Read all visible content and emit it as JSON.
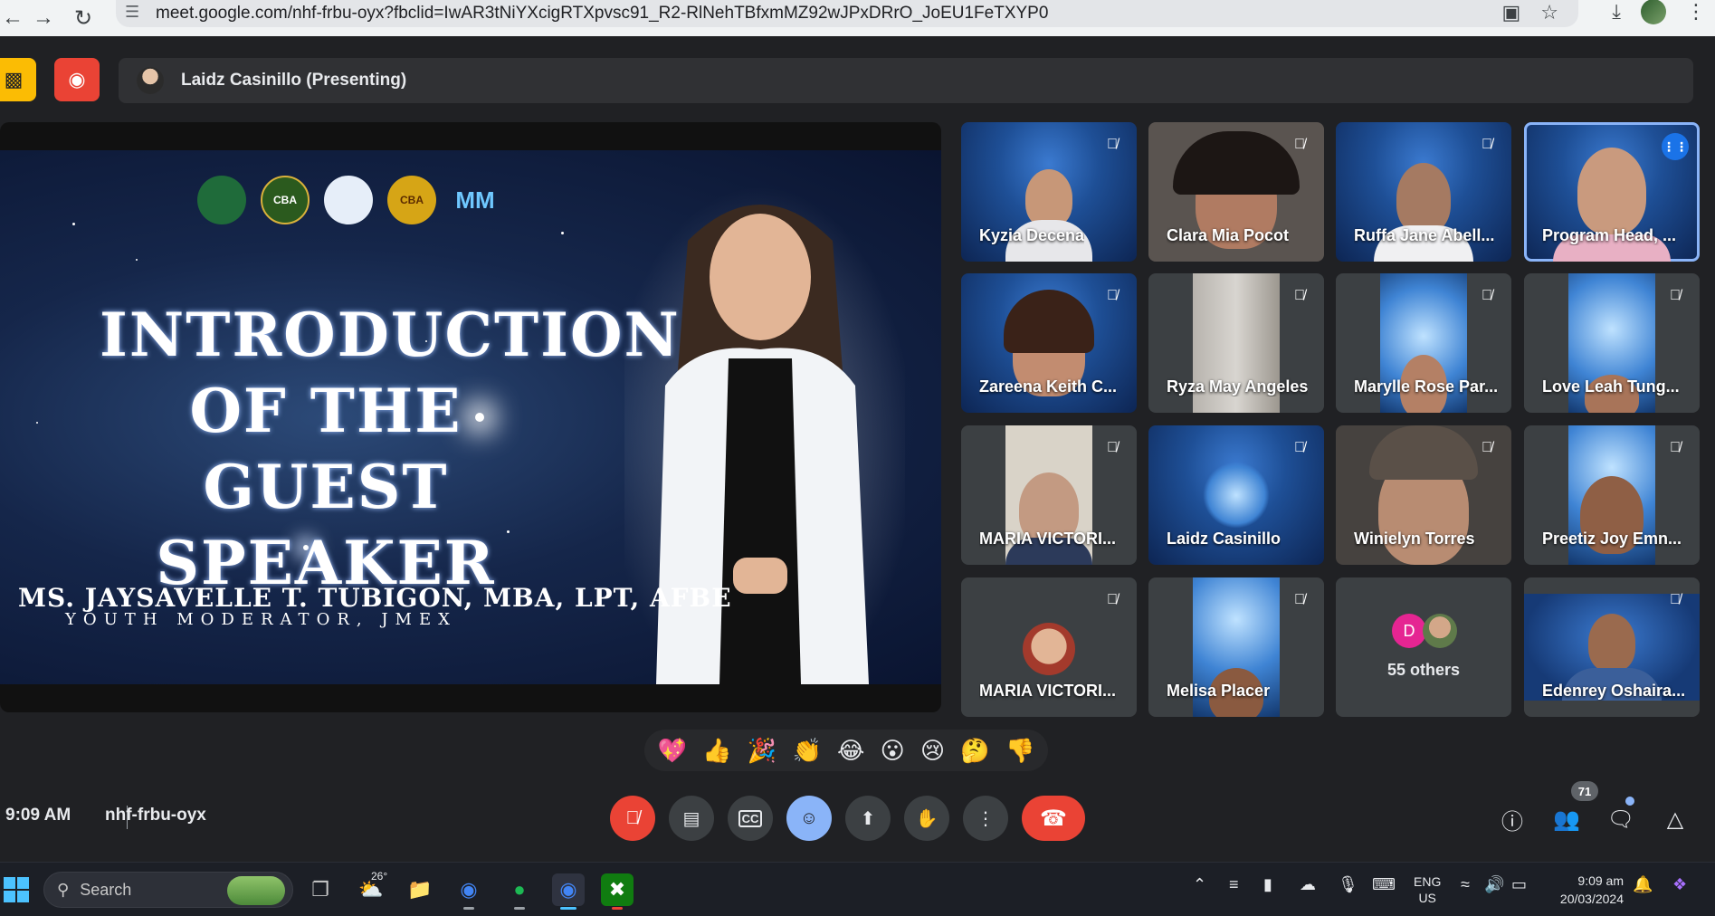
{
  "browser": {
    "url": "meet.google.com/nhf-frbu-oyx?fbclid=IwAR3tNiYXcigRTXpvsc91_R2-RlNehTBfxmMZ92wJPxDRrO_JoEU1FeTXYP0"
  },
  "top_bar": {
    "presenter_label": "Laidz Casinillo (Presenting)"
  },
  "slide": {
    "logo_labels": [
      "",
      "CBA",
      "",
      "CBA",
      "MM"
    ],
    "title_lines": [
      "INTRODUCTION",
      "OF THE",
      "GUEST SPEAKER"
    ],
    "speaker_name": "MS. JAYSAVELLE T. TUBIGON, MBA, LPT, AFBE",
    "speaker_role": "YOUTH MODERATOR, JMEX"
  },
  "participants": [
    {
      "name": "Kyzia Decena"
    },
    {
      "name": "Clara Mia Pocot"
    },
    {
      "name": "Ruffa Jane Abell..."
    },
    {
      "name": "Program Head, ..."
    },
    {
      "name": "Zareena Keith C..."
    },
    {
      "name": "Ryza May Angeles"
    },
    {
      "name": "Marylle Rose Par..."
    },
    {
      "name": "Love Leah Tung..."
    },
    {
      "name": "MARIA VICTORI..."
    },
    {
      "name": "Laidz Casinillo"
    },
    {
      "name": "Winielyn Torres"
    },
    {
      "name": "Preetiz Joy Emn..."
    },
    {
      "name": "MARIA VICTORI..."
    },
    {
      "name": "Melisa Placer"
    },
    {
      "name": "Edenrey Oshaira..."
    }
  ],
  "others_tile": {
    "initial": "D",
    "label": "55 others"
  },
  "reactions": [
    "💖",
    "👍",
    "🎉",
    "👏",
    "😂",
    "😮",
    "😢",
    "🤔",
    "👎"
  ],
  "meeting": {
    "time": "9:09 AM",
    "code": "nhf-frbu-oyx",
    "participant_count": "71"
  },
  "taskbar": {
    "search_label": "Search",
    "weather_temp": "26°",
    "lang_line1": "ENG",
    "lang_line2": "US",
    "time": "9:09 am",
    "date": "20/03/2024"
  },
  "colors": {
    "accent_blue": "#8ab4f8",
    "hangup_red": "#ea4335",
    "speaking_blue": "#1a73e8"
  }
}
